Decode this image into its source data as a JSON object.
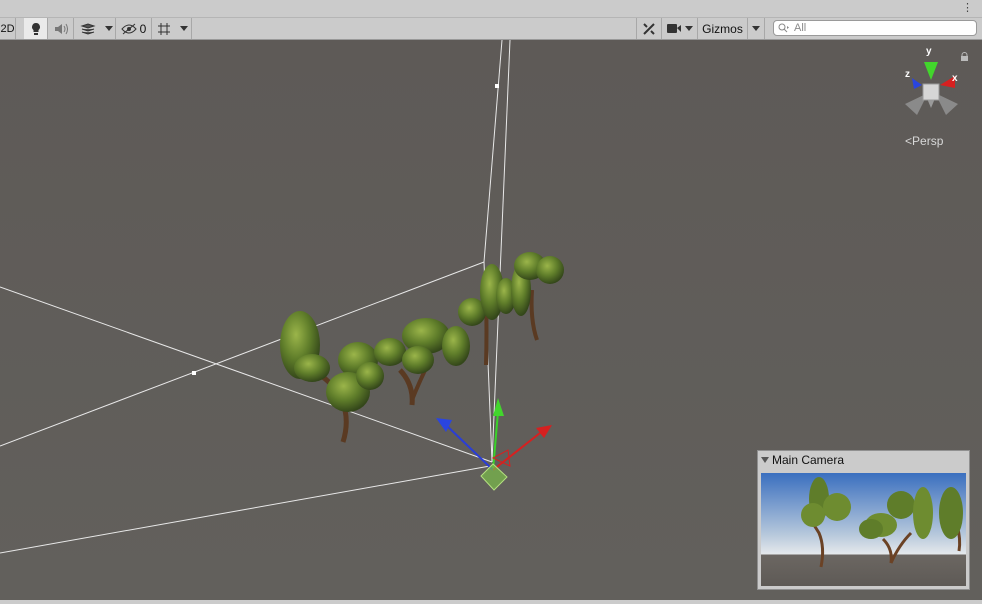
{
  "window": {
    "menu_icon": "vertical-ellipsis-icon"
  },
  "toolbar": {
    "mode_2d_label": "2D",
    "lighting_icon": "lightbulb-icon",
    "audio_icon": "speaker-icon",
    "effects_icon": "effects-stack-icon",
    "hidden_count": "0",
    "visibility_icon": "eye-slash-icon",
    "grid_icon": "grid-icon",
    "tools_icon": "tools-icon",
    "camera_icon": "video-camera-icon",
    "gizmos_label": "Gizmos",
    "search_placeholder": "All",
    "search_icon": "search-icon"
  },
  "scene_gizmo": {
    "axis_x": "x",
    "axis_y": "y",
    "axis_z": "z",
    "projection_label": "Persp",
    "lock_icon": "lock-icon"
  },
  "camera_preview": {
    "title": "Main Camera",
    "foldout_icon": "triangle-down-icon"
  },
  "colors": {
    "x_axis": "#d62020",
    "y_axis": "#3ad22a",
    "z_axis": "#2a3dd6",
    "scene_bg": "#5e5a57",
    "toolbar_bg": "#cbcbcb"
  }
}
